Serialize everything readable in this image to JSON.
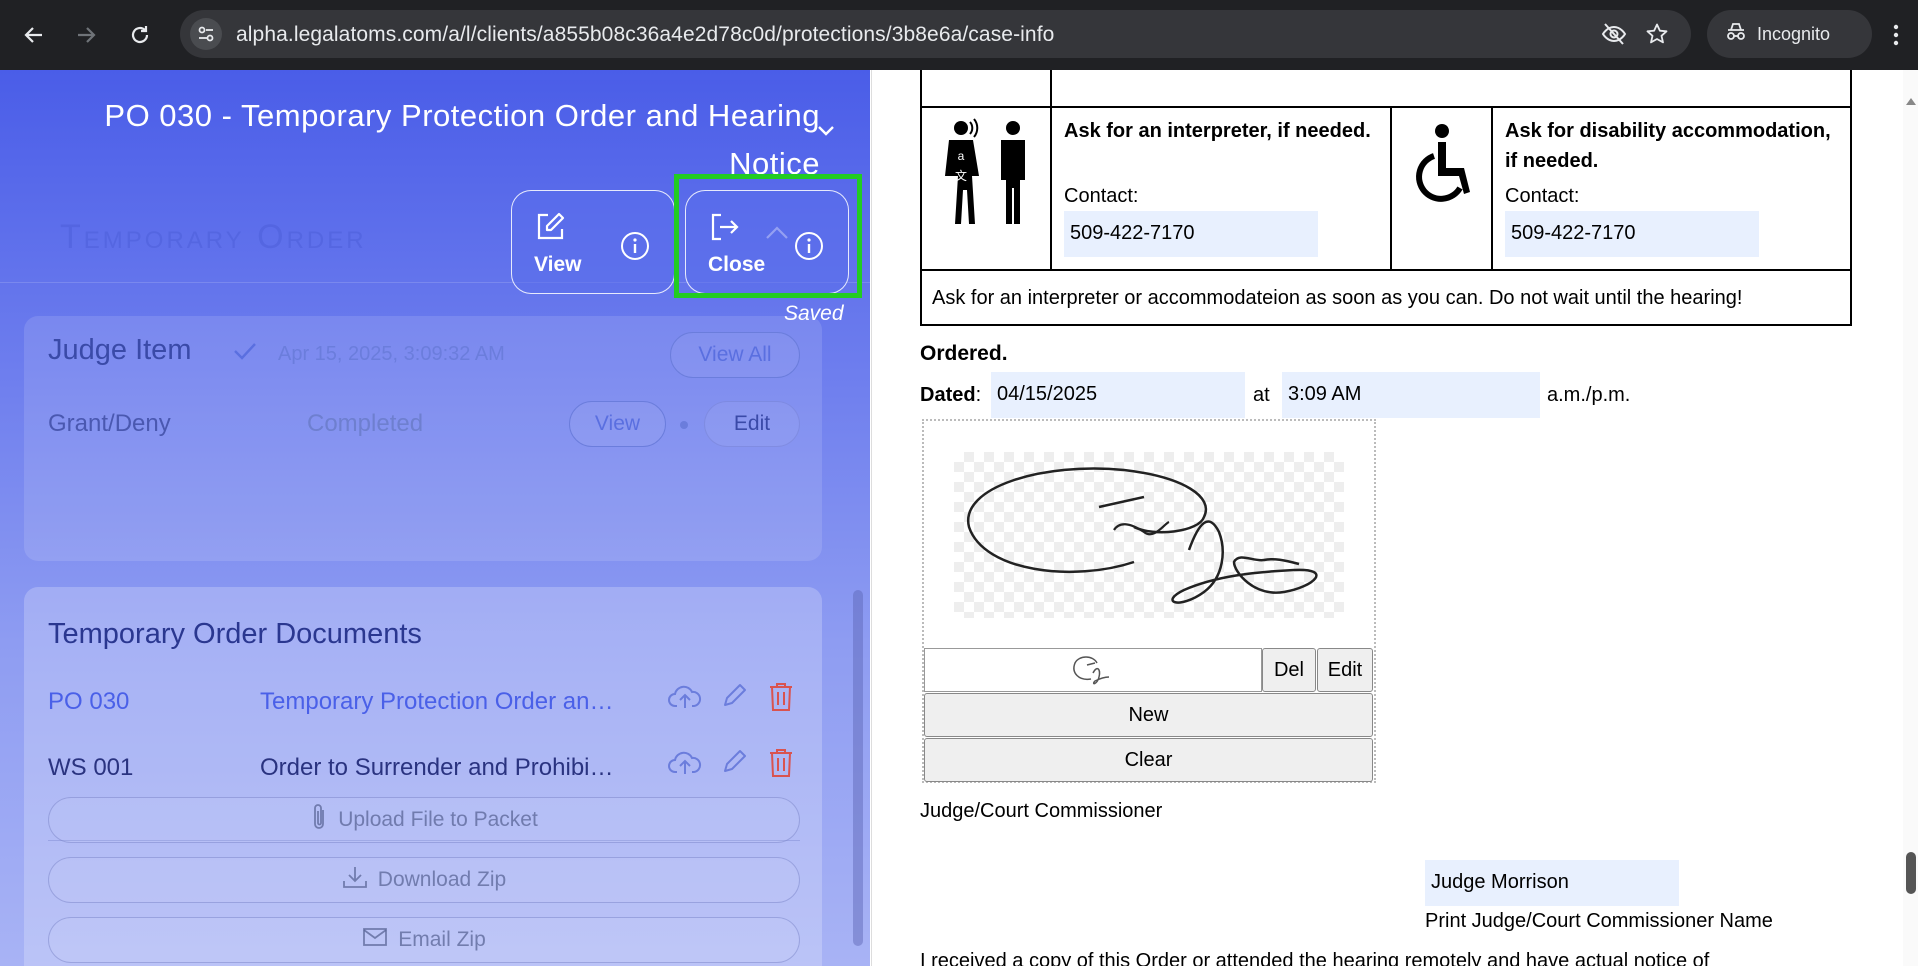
{
  "browser": {
    "url": "alpha.legalatoms.com/a/l/clients/a855b08c36a4e2d78c0d/protections/3b8e6a/case-info",
    "incognito_label": "Incognito"
  },
  "left_panel": {
    "document_title": "PO 030 - Temporary Protection Order and Hearing Notice",
    "watermark": "Temporary Order",
    "view_button": "View",
    "close_button": "Close",
    "saved_label": "Saved",
    "judge": {
      "title": "Judge Item",
      "date": "Apr 15, 2025, 3:09:32 AM",
      "view_all": "View All",
      "row_label": "Grant/Deny",
      "row_status": "Completed",
      "view": "View",
      "edit": "Edit"
    },
    "documents": {
      "title": "Temporary Order Documents",
      "rows": [
        {
          "code": "PO 030",
          "name": "Temporary Protection Order and Hearing Notice"
        },
        {
          "code": "WS 001",
          "name": "Order to Surrender and Prohibit Weapons"
        }
      ],
      "upload": "Upload File to Packet",
      "download": "Download Zip",
      "email": "Email Zip"
    }
  },
  "document": {
    "interpreter_title": "Ask for an interpreter, if needed.",
    "interpreter_contact_label": "Contact:",
    "interpreter_phone": "509-422-7170",
    "disability_title": "Ask for disability accommodation, if needed.",
    "disability_contact_label": "Contact:",
    "disability_phone": "509-422-7170",
    "warning": "Ask for an interpreter or accommodateion as soon as you can. Do not wait until the hearing!",
    "ordered": "Ordered.",
    "dated_label": "Dated",
    "dated_colon": ":",
    "date_value": "04/15/2025",
    "at_label": "at",
    "time_value": "3:09 AM",
    "ampm": "a.m./p.m.",
    "sig_del": "Del",
    "sig_edit": "Edit",
    "sig_new": "New",
    "sig_clear": "Clear",
    "judge_caption": "Judge/Court Commissioner",
    "judge_name": "Judge Morrison",
    "print_caption": "Print Judge/Court Commissioner Name",
    "bottom_text": "I received a copy of this Order or attended the hearing remotely and have actual notice of"
  },
  "colors": {
    "panel_gradient_top": "#4a5de8",
    "accent": "#5a6fe0",
    "highlight": "#22cc22",
    "delete_icon": "#d9534f",
    "input_bg": "#e8f0fe"
  }
}
